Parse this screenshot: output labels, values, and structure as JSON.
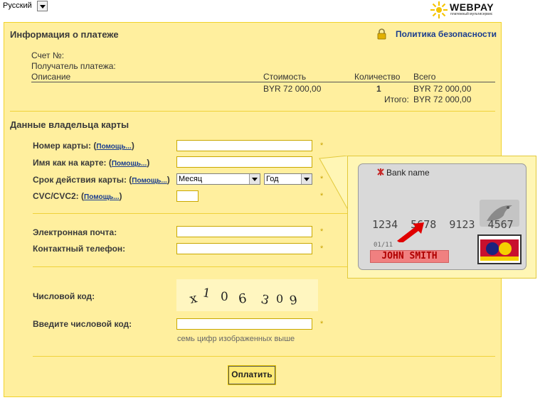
{
  "language": {
    "selected": "Русский"
  },
  "logo": {
    "text": "WEBPAY",
    "subtitle": "платежный мультисервис"
  },
  "payment_info": {
    "title": "Информация о платеже",
    "policy_link": "Политика безопасности",
    "account_label": "Счет №:",
    "recipient_label": "Получатель платежа:",
    "columns": [
      "Описание",
      "Стоимость",
      "Количество",
      "Всего"
    ],
    "row": {
      "description": "",
      "cost": "BYR 72 000,00",
      "quantity": "1",
      "total": "BYR 72 000,00"
    },
    "total_label": "Итого:",
    "total_value": "BYR 72 000,00"
  },
  "cardholder": {
    "title": "Данные владельца карты",
    "help_text": "Помощь...",
    "card_number_label": "Номер карты:",
    "name_on_card_label": "Имя как на карте:",
    "expiry_label": "Срок действия карты:",
    "month_value": "Месяц",
    "year_value": "Год",
    "cvc_label": "CVC/CVC2:",
    "email_label": "Электронная почта:",
    "phone_label": "Контактный телефон:",
    "captcha_label": "Числовой код:",
    "captcha_text": "x106309",
    "enter_code_label": "Введите числовой код:",
    "code_hint": "семь цифр изображенных выше",
    "required_mark": "*",
    "submit": "Оплатить"
  },
  "card_illustration": {
    "bank_name": "Bank name",
    "number": "1234  5678  9123  4567",
    "expiry": "01/11",
    "holder": "JOHN SMITH"
  },
  "colors": {
    "panel_bg": "#ffef9e",
    "panel_border": "#f1d22b",
    "link": "#1a3d8f",
    "highlight": "#f08080"
  }
}
